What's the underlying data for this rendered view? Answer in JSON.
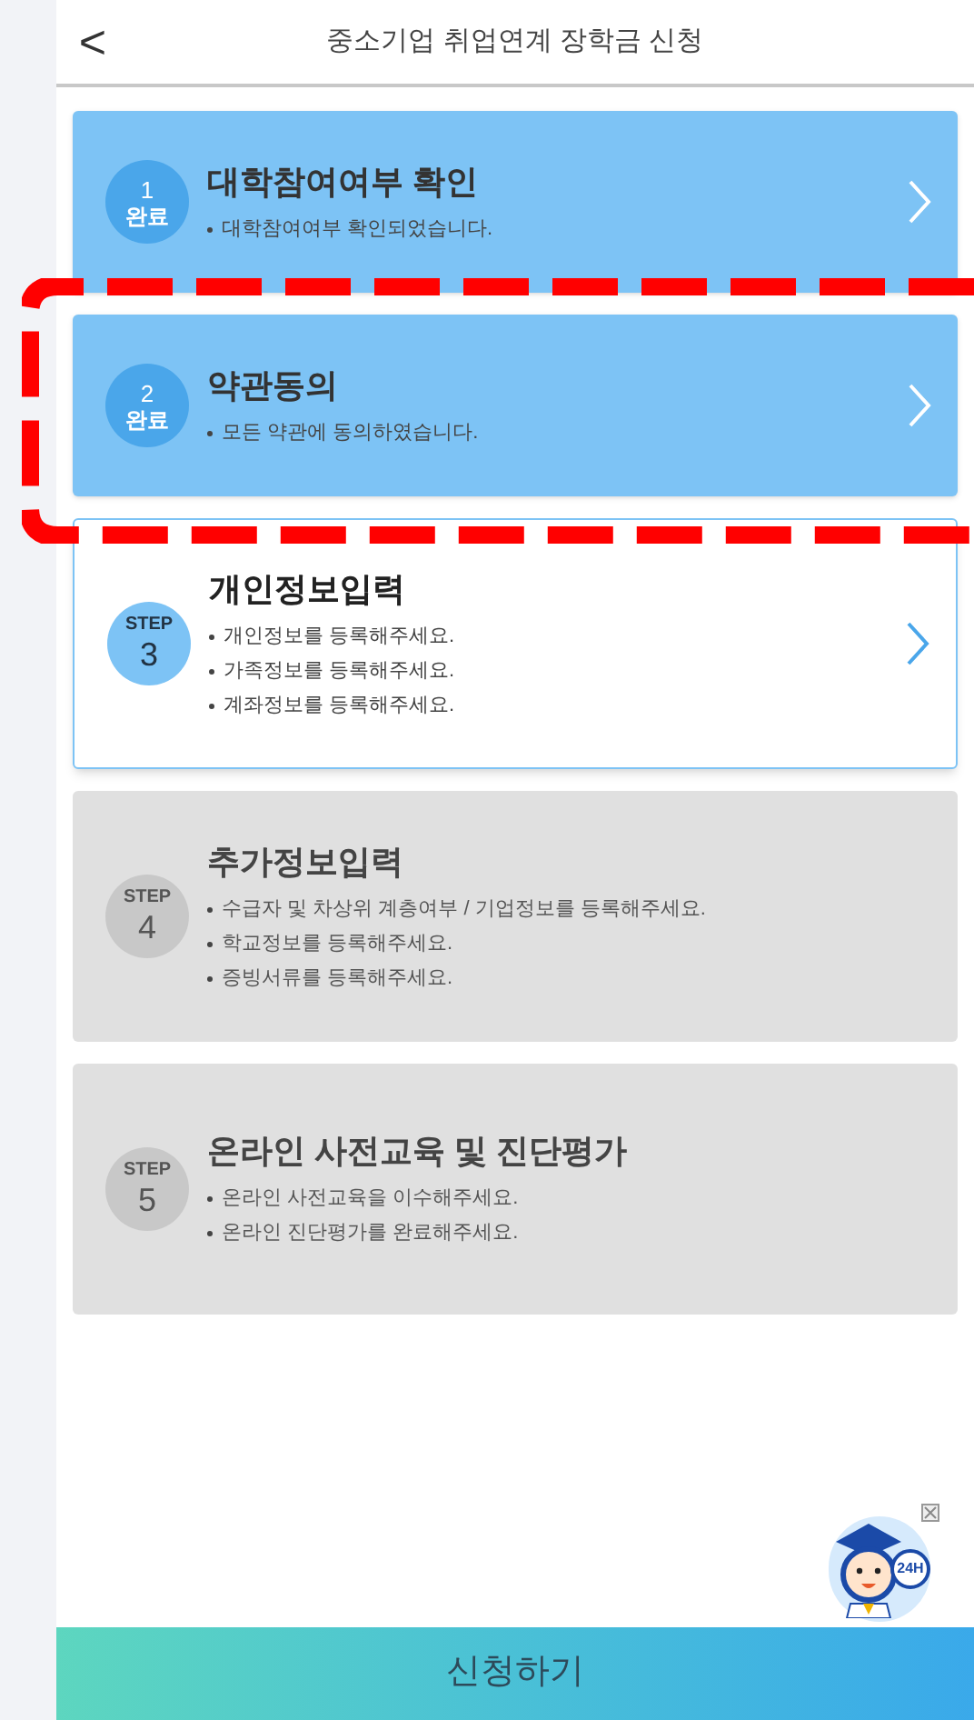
{
  "header": {
    "back_icon": "<",
    "title": "중소기업 취업연계 장학금 신청"
  },
  "steps": [
    {
      "kind": "done",
      "number": "1",
      "badge_label": "완료",
      "title": "대학참여여부 확인",
      "notes": [
        "대학참여여부 확인되었습니다."
      ]
    },
    {
      "kind": "done",
      "number": "2",
      "badge_label": "완료",
      "title": "약관동의",
      "notes": [
        "모든 약관에 동의하였습니다."
      ]
    },
    {
      "kind": "current",
      "number": "3",
      "badge_label": "STEP",
      "title": "개인정보입력",
      "notes": [
        "개인정보를 등록해주세요.",
        "가족정보를 등록해주세요.",
        "계좌정보를 등록해주세요."
      ]
    },
    {
      "kind": "pending",
      "number": "4",
      "badge_label": "STEP",
      "title": "추가정보입력",
      "notes": [
        "수급자 및 차상위 계층여부 / 기업정보를 등록해주세요.",
        "학교정보를 등록해주세요.",
        "증빙서류를 등록해주세요."
      ]
    },
    {
      "kind": "pending",
      "number": "5",
      "badge_label": "STEP",
      "title": "온라인 사전교육 및 진단평가",
      "notes": [
        "온라인 사전교육을 이수해주세요.",
        "온라인 진단평가를 완료해주세요."
      ]
    }
  ],
  "chatbot": {
    "badge": "24H"
  },
  "submit_button": "신청하기"
}
